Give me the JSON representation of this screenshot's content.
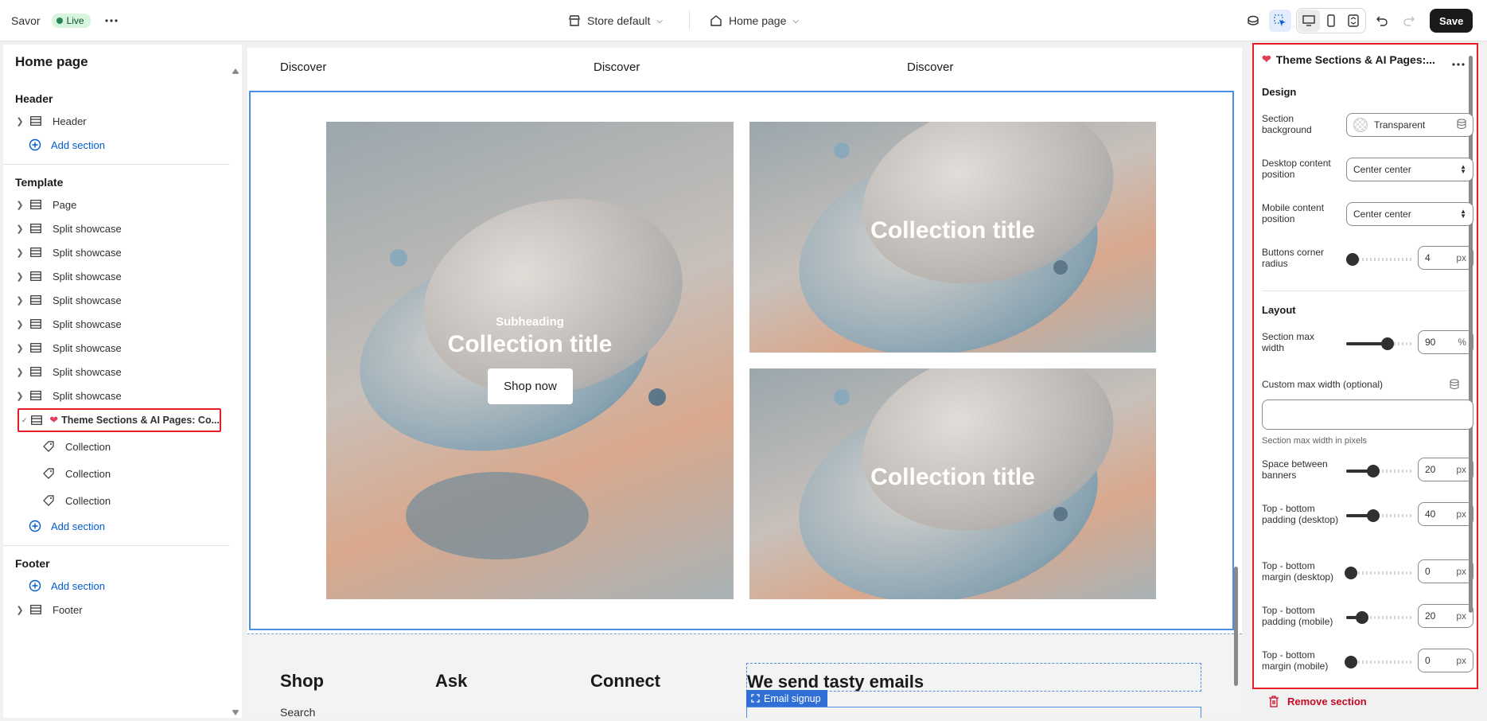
{
  "topbar": {
    "store_name": "Savor",
    "status": "Live",
    "theme_selector": "Store default",
    "page_selector": "Home page",
    "save_label": "Save"
  },
  "sidebar": {
    "title": "Home page",
    "header_group": "Header",
    "header_items": [
      "Header"
    ],
    "add_section": "Add section",
    "template_group": "Template",
    "template_items": [
      "Page",
      "Split showcase",
      "Split showcase",
      "Split showcase",
      "Split showcase",
      "Split showcase",
      "Split showcase",
      "Split showcase",
      "Split showcase"
    ],
    "selected_item": "Theme Sections & AI Pages: Co...",
    "children": [
      "Collection",
      "Collection",
      "Collection"
    ],
    "footer_group": "Footer",
    "footer_items": [
      "Footer"
    ]
  },
  "canvas": {
    "nav": [
      "Discover",
      "Discover",
      "Discover"
    ],
    "main_banner": {
      "subheading": "Subheading",
      "title": "Collection title",
      "button": "Shop now"
    },
    "side_banners": [
      {
        "title": "Collection title"
      },
      {
        "title": "Collection title"
      }
    ],
    "footer_columns": [
      "Shop",
      "Ask",
      "Connect"
    ],
    "newsletter_title": "We send tasty emails",
    "email_signup_badge": "Email signup",
    "footer_link": "Search"
  },
  "settings": {
    "title": "Theme Sections & AI Pages:...",
    "design_heading": "Design",
    "section_background_label": "Section background",
    "section_background_value": "Transparent",
    "desktop_position_label": "Desktop content position",
    "desktop_position_value": "Center center",
    "mobile_position_label": "Mobile content position",
    "mobile_position_value": "Center center",
    "corner_radius_label": "Buttons corner radius",
    "corner_radius_value": "4",
    "layout_heading": "Layout",
    "max_width_label": "Section max width",
    "max_width_value": "90",
    "custom_width_label": "Custom max width (optional)",
    "custom_width_value": "",
    "custom_width_help": "Section max width in pixels",
    "space_label": "Space between banners",
    "space_value": "20",
    "pad_desktop_label": "Top - bottom padding (desktop)",
    "pad_desktop_value": "40",
    "margin_desktop_label": "Top - bottom margin (desktop)",
    "margin_desktop_value": "0",
    "pad_mobile_label": "Top - bottom padding (mobile)",
    "pad_mobile_value": "20",
    "margin_mobile_label": "Top - bottom margin (mobile)",
    "margin_mobile_value": "0",
    "unit_px": "px",
    "unit_percent": "%",
    "remove_label": "Remove section"
  },
  "colors": {
    "accent": "#005bd3",
    "selection": "#e51c23",
    "frame": "#4a8fe7",
    "live": "#29845a"
  }
}
